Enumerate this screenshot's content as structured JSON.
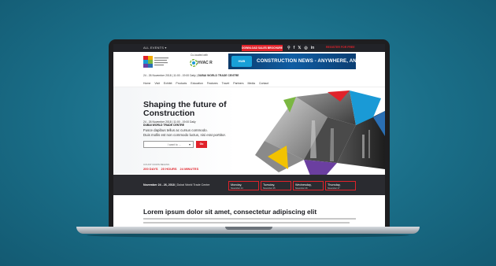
{
  "topbar": {
    "all_events": "ALL EVENTS ▾",
    "download_label": "DOWNLOAD SALES BROCHURE",
    "icons": [
      "search-icon",
      "facebook-icon",
      "twitter-icon",
      "instagram-icon",
      "linkedin-icon"
    ],
    "icon_glyphs": [
      "⚲",
      "f",
      "𝕏",
      "◎",
      "in"
    ],
    "register_label": "REGISTER FOR FREE"
  },
  "header": {
    "colocated": "Co-located with",
    "hvacr": "HVAC R",
    "banner_hub": "HUB",
    "banner_text": "CONSTRUCTION NEWS - ANYWHERE, ANYTIME",
    "dateline_dates": "24 - 26 November 2018",
    "dateline_time": "11:00 - 19:00 Daily",
    "dateline_venue": "DUBAI WORLD TRADE CENTRE",
    "sep": "|"
  },
  "nav": [
    "Home",
    "Visit",
    "Exhibit",
    "Products",
    "Education",
    "Features",
    "Travel",
    "Partners",
    "Media",
    "Contact"
  ],
  "hero": {
    "title": "Shaping the future of Construction",
    "date": "24 - 26 November 2018  |  11:00 - 19:00 Daily",
    "venue": "DUBAI WORLD TRADE CENTRE",
    "line1": "Fusce dapibus tellus ac cursus commodo.",
    "line2": "Duis mollis est non commodo luctus, nisi erat porttitor.",
    "select_text": "I want to ...",
    "go_label": "Go",
    "count_label": "COUNT DOWN BEGINS",
    "countdown": [
      "200 DAYS",
      "20 HOURS",
      "24 MINUTES"
    ]
  },
  "strip": {
    "dates": "November 24 - 26, 2018",
    "venue": "Dubai World Trade Centre",
    "days": [
      {
        "day": "Monday,",
        "date": "November 24"
      },
      {
        "day": "Tuesday,",
        "date": "November 25"
      },
      {
        "day": "Wednesday,",
        "date": "November 26"
      },
      {
        "day": "Thursday,",
        "date": "November 27"
      }
    ]
  },
  "content": {
    "heading": "Lorem ipsum dolor sit amet, consectetur adipiscing elit"
  },
  "colors": {
    "accent": "#e0222a",
    "dark": "#222328",
    "background": "#1b6f89",
    "banner": "#0f5da3"
  }
}
